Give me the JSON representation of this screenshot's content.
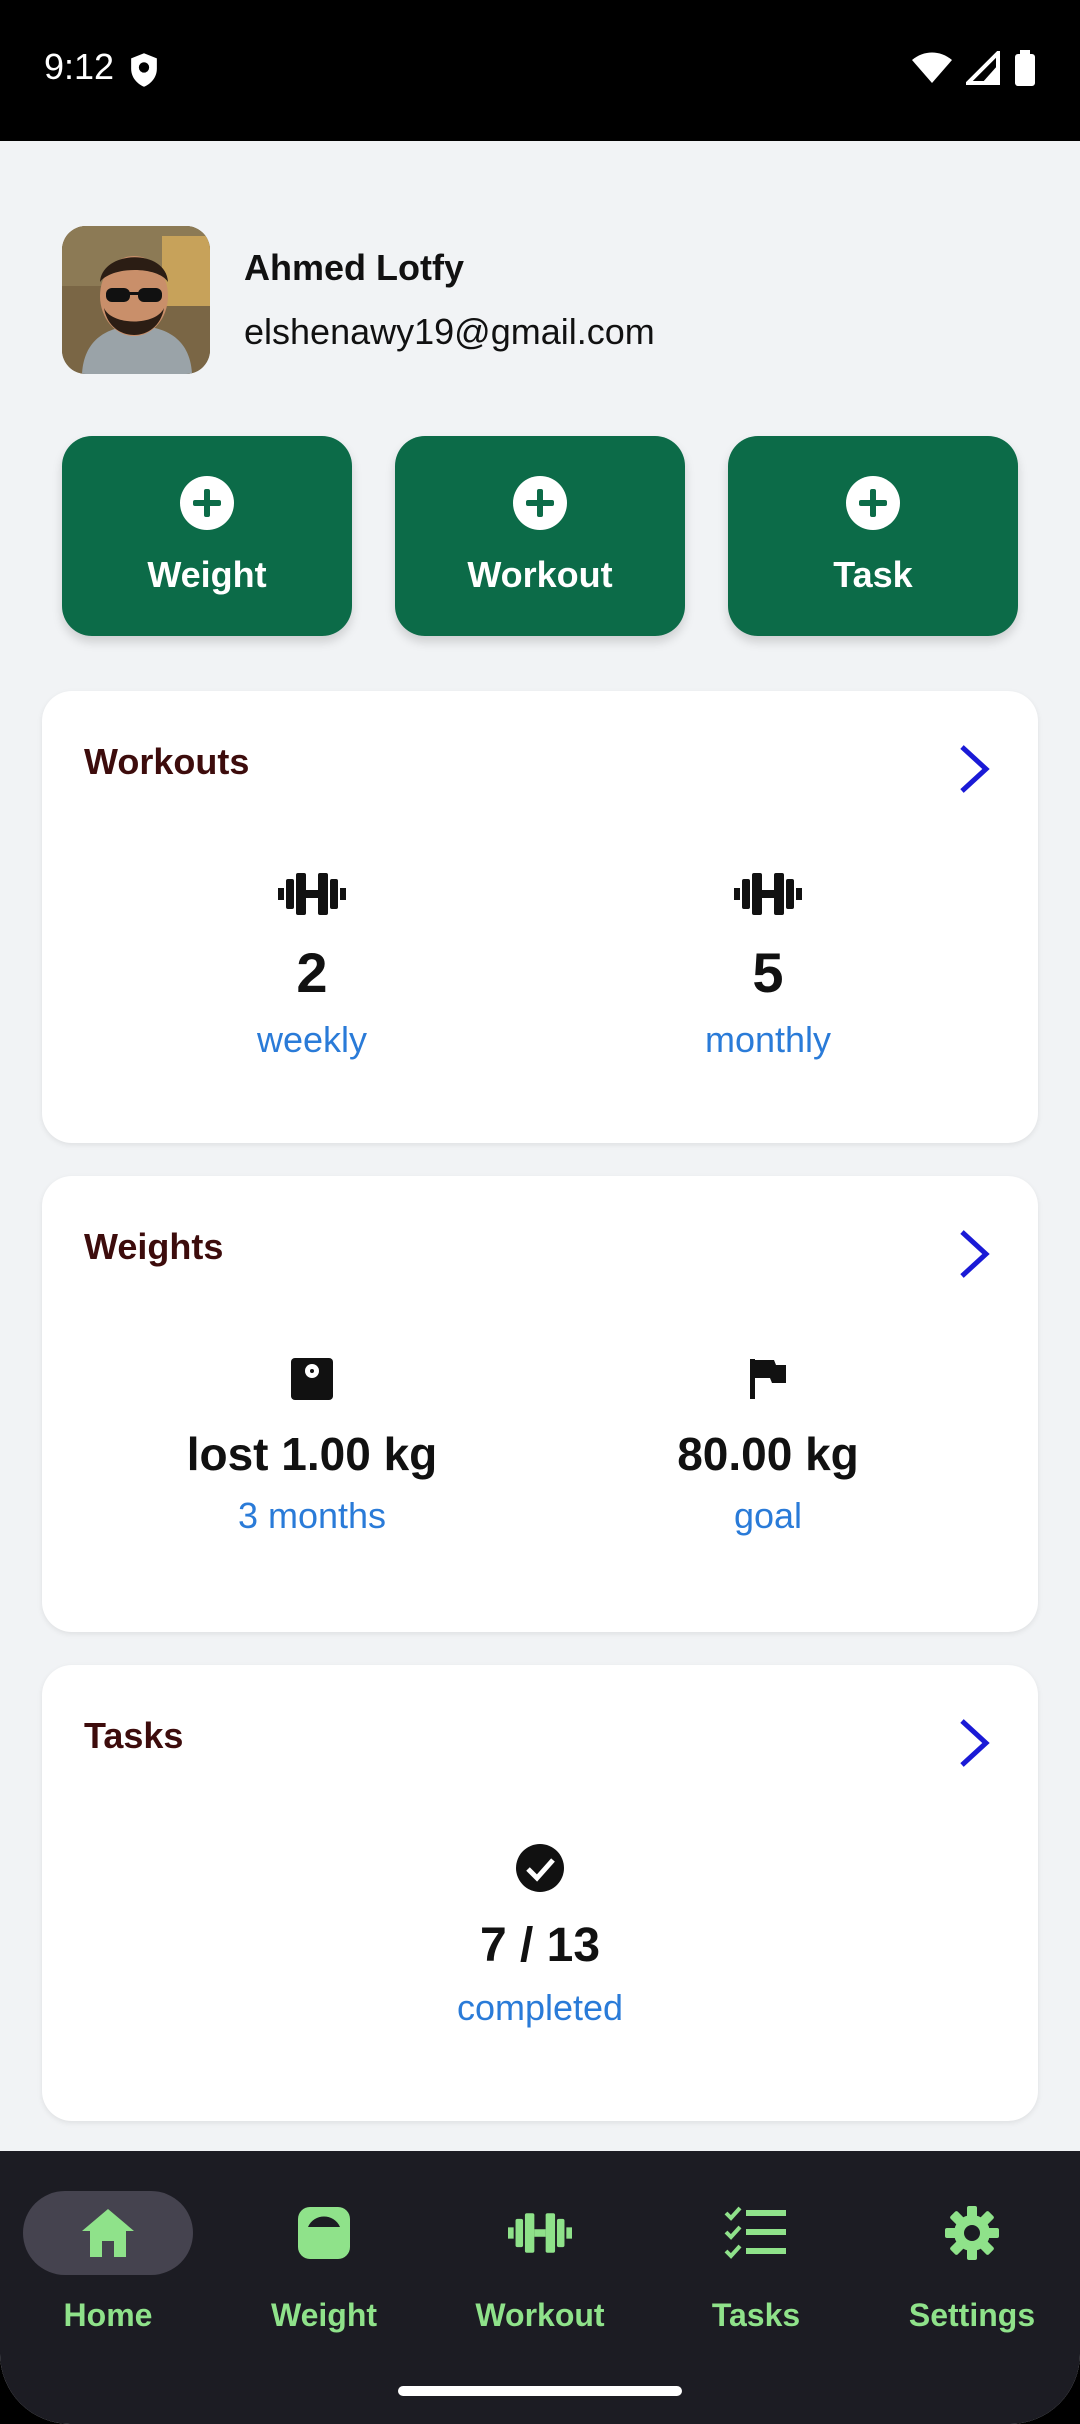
{
  "status_bar": {
    "time": "9:12"
  },
  "profile": {
    "name": "Ahmed Lotfy",
    "email": "elshenawy19@gmail.com"
  },
  "quick_actions": [
    {
      "label": "Weight",
      "icon": "add-circle-icon"
    },
    {
      "label": "Workout",
      "icon": "add-circle-icon"
    },
    {
      "label": "Task",
      "icon": "add-circle-icon"
    }
  ],
  "workouts_card": {
    "title": "Workouts",
    "weekly_value": "2",
    "weekly_label": "weekly",
    "monthly_value": "5",
    "monthly_label": "monthly"
  },
  "weights_card": {
    "title": "Weights",
    "lost_value": "lost 1.00 kg",
    "lost_label": "3 months",
    "goal_value": "80.00 kg",
    "goal_label": "goal"
  },
  "tasks_card": {
    "title": "Tasks",
    "progress": "7 / 13",
    "progress_label": "completed"
  },
  "bottom_nav": [
    {
      "label": "Home",
      "icon": "home-icon",
      "active": true
    },
    {
      "label": "Weight",
      "icon": "scale-icon"
    },
    {
      "label": "Workout",
      "icon": "dumbbell-icon"
    },
    {
      "label": "Tasks",
      "icon": "checklist-icon"
    },
    {
      "label": "Settings",
      "icon": "gear-icon"
    }
  ],
  "colors": {
    "accent": "#0c6b48",
    "nav_bg": "#1c1c23",
    "nav_label": "#8fe28a",
    "link": "#2a7bd8",
    "card_title": "#3d0c0c"
  }
}
